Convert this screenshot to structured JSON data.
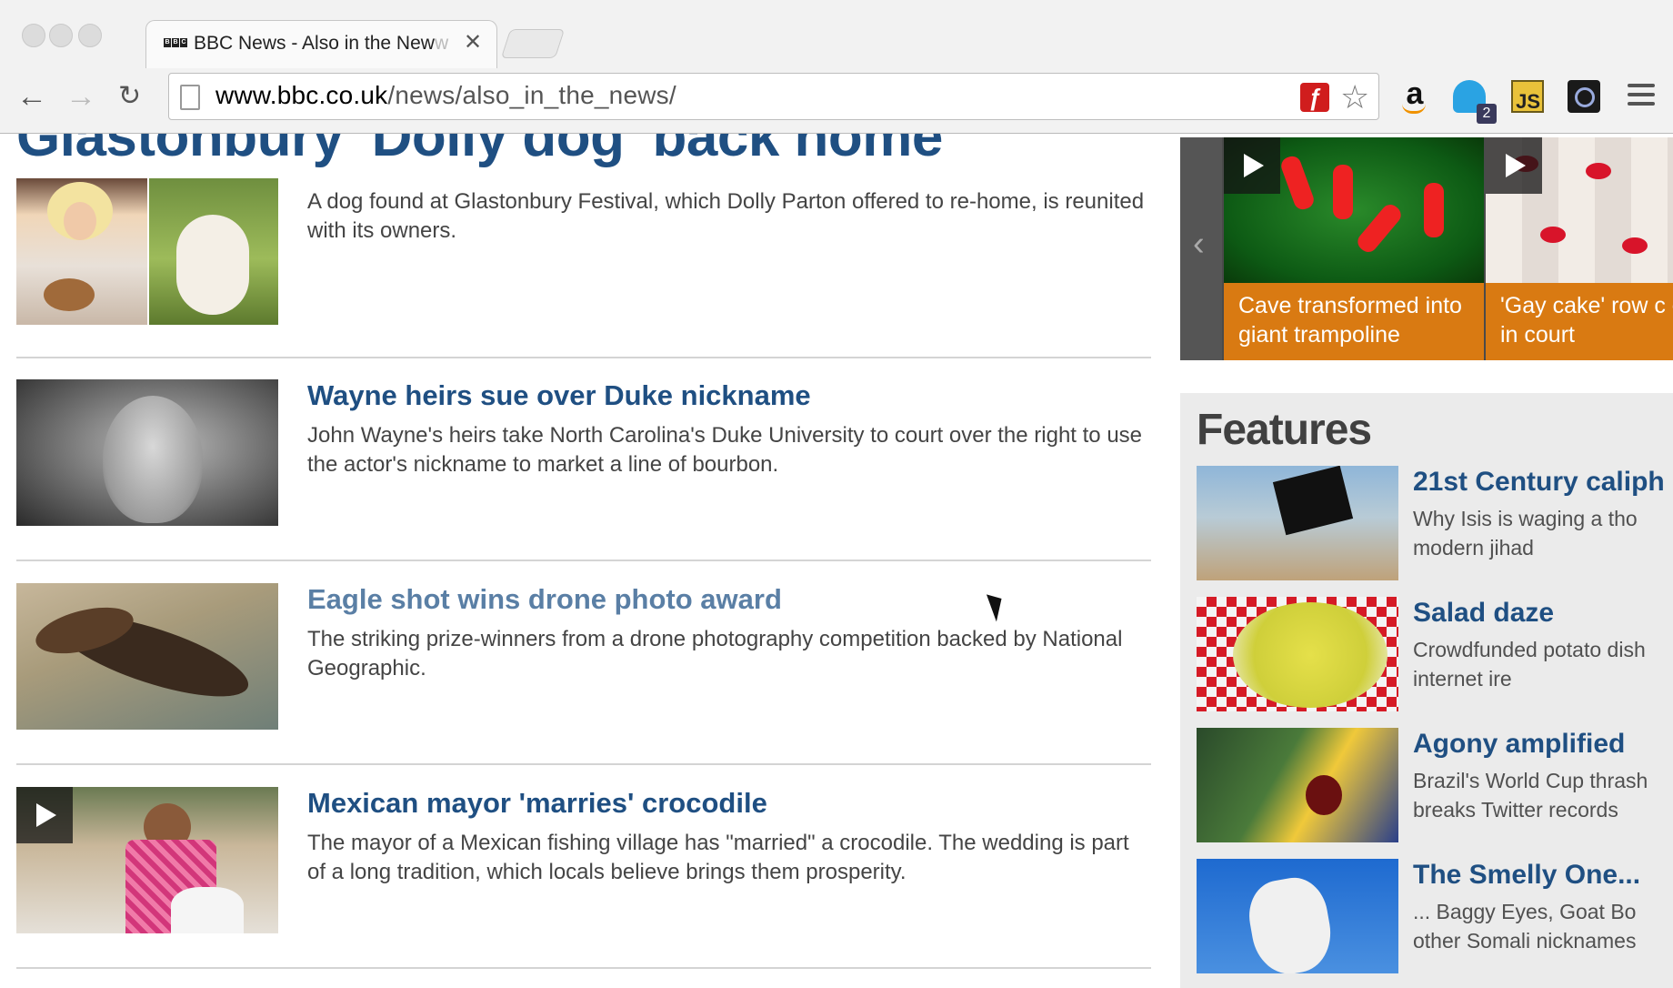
{
  "browser": {
    "tab_title": "BBC News - Also in the New",
    "tab_title_fade": "w",
    "tab_favicon_letters": [
      "B",
      "B",
      "C"
    ],
    "url_host": "www.bbc.co.uk",
    "url_path": "/news/also_in_the_news/",
    "extensions": [
      "amazon-icon",
      "ghostery-icon",
      "js-icon",
      "camera-icon"
    ],
    "ghostery_badge": "2"
  },
  "hero": {
    "title": "Glastonbury 'Dolly dog' back home"
  },
  "stories": [
    {
      "headline": "",
      "summary": "A dog found at Glastonbury Festival, which Dolly Parton offered to re-home, is reunited with its owners."
    },
    {
      "headline": "Wayne heirs sue over Duke nickname",
      "summary": "John Wayne's heirs take North Carolina's Duke University to court over the right to use the actor's nickname to market a line of bourbon."
    },
    {
      "headline": "Eagle shot wins drone photo award",
      "summary": "The striking prize-winners from a drone photography competition backed by National Geographic."
    },
    {
      "headline": "Mexican mayor 'marries' crocodile",
      "summary": "The mayor of a Mexican fishing village has \"married\" a crocodile. The wedding is part of a long tradition, which locals believe brings them prosperity."
    }
  ],
  "carousel": [
    {
      "caption": "Cave transformed into giant trampoline"
    },
    {
      "caption": "'Gay cake' row c end up in court"
    }
  ],
  "features": {
    "title": "Features",
    "items": [
      {
        "headline": "21st Century caliph",
        "summary": "Why Isis is waging a tho modern jihad"
      },
      {
        "headline": "Salad daze",
        "summary": "Crowdfunded potato dish internet ire"
      },
      {
        "headline": "Agony amplified",
        "summary": "Brazil's World Cup thrash breaks Twitter records"
      },
      {
        "headline": "The Smelly One...",
        "summary": "... Baggy Eyes, Goat Bo other Somali nicknames"
      }
    ]
  },
  "colors": {
    "headline_blue": "#1f4f82",
    "carousel_caption_orange": "#d97a12",
    "features_bg": "#ebebeb"
  }
}
